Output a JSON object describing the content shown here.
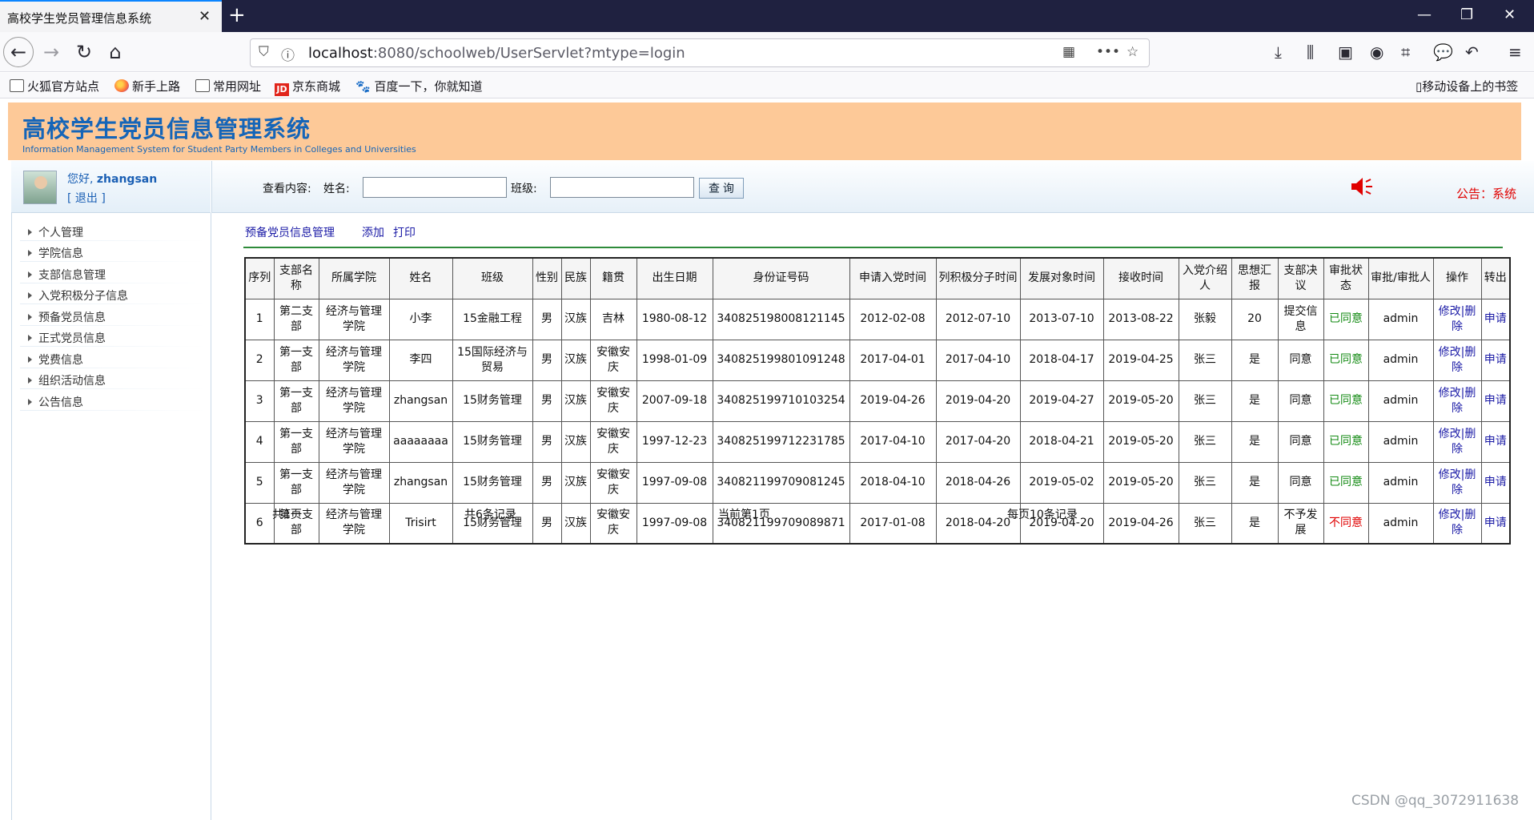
{
  "browser": {
    "tab_title": "高校学生党员管理信息系统",
    "url_host": "localhost",
    "url_rest": ":8080/schoolweb/UserServlet?mtype=login",
    "bookmarks": [
      "火狐官方站点",
      "新手上路",
      "常用网址",
      "京东商城",
      "百度一下，你就知道"
    ],
    "mobile_bookmarks": "移动设备上的书签"
  },
  "header": {
    "title": "高校学生党员信息管理系统",
    "subtitle": "Information Management System for Student Party Members in Colleges and Universities"
  },
  "user": {
    "greeting": "您好,",
    "name": "zhangsan",
    "logout": "[ 退出 ]"
  },
  "search": {
    "prefix": "查看内容:",
    "name_label": "姓名:",
    "name_value": "",
    "class_label": "班级:",
    "class_value": "",
    "button": "查 询",
    "notice": "公告：系统"
  },
  "sidebar": {
    "items": [
      "个人管理",
      "学院信息",
      "支部信息管理",
      "入党积极分子信息",
      "预备党员信息",
      "正式党员信息",
      "党费信息",
      "组织活动信息",
      "公告信息"
    ]
  },
  "content": {
    "section_title": "预备党员信息管理",
    "add": "添加",
    "print": "打印"
  },
  "table": {
    "headers": [
      "序列",
      "支部名称",
      "所属学院",
      "姓名",
      "班级",
      "性别",
      "民族",
      "籍贯",
      "出生日期",
      "身份证号码",
      "申请入党时间",
      "列积极分子时间",
      "发展对象时间",
      "接收时间",
      "入党介绍人",
      "思想汇报",
      "支部决议",
      "审批状态",
      "审批/审批人",
      "操作",
      "转出"
    ],
    "rows": [
      [
        "1",
        "第二支部",
        "经济与管理学院",
        "小李",
        "15金融工程",
        "男",
        "汉族",
        "吉林",
        "1980-08-12",
        "340825198008121145",
        "2012-02-08",
        "2012-07-10",
        "2013-07-10",
        "2013-08-22",
        "张毅",
        "20",
        "提交信息",
        "已同意",
        "admin",
        "修改|删除",
        "申请"
      ],
      [
        "2",
        "第一支部",
        "经济与管理学院",
        "李四",
        "15国际经济与贸易",
        "男",
        "汉族",
        "安徽安庆",
        "1998-01-09",
        "340825199801091248",
        "2017-04-01",
        "2017-04-10",
        "2018-04-17",
        "2019-04-25",
        "张三",
        "是",
        "同意",
        "已同意",
        "admin",
        "修改|删除",
        "申请"
      ],
      [
        "3",
        "第一支部",
        "经济与管理学院",
        "zhangsan",
        "15财务管理",
        "男",
        "汉族",
        "安徽安庆",
        "2007-09-18",
        "340825199710103254",
        "2019-04-26",
        "2019-04-20",
        "2019-04-27",
        "2019-05-20",
        "张三",
        "是",
        "同意",
        "已同意",
        "admin",
        "修改|删除",
        "申请"
      ],
      [
        "4",
        "第一支部",
        "经济与管理学院",
        "aaaaaaaa",
        "15财务管理",
        "男",
        "汉族",
        "安徽安庆",
        "1997-12-23",
        "340825199712231785",
        "2017-04-10",
        "2017-04-20",
        "2018-04-21",
        "2019-05-20",
        "张三",
        "是",
        "同意",
        "已同意",
        "admin",
        "修改|删除",
        "申请"
      ],
      [
        "5",
        "第一支部",
        "经济与管理学院",
        "zhangsan",
        "15财务管理",
        "男",
        "汉族",
        "安徽安庆",
        "1997-09-08",
        "340821199709081245",
        "2018-04-10",
        "2018-04-26",
        "2019-05-02",
        "2019-05-20",
        "张三",
        "是",
        "同意",
        "已同意",
        "admin",
        "修改|删除",
        "申请"
      ],
      [
        "6",
        "第一支部",
        "经济与管理学院",
        "Trisirt",
        "15财务管理",
        "男",
        "汉族",
        "安徽安庆",
        "1997-09-08",
        "340821199709089871",
        "2017-01-08",
        "2018-04-20",
        "2019-04-20",
        "2019-04-26",
        "张三",
        "是",
        "不予发展",
        "不同意",
        "admin",
        "修改|删除",
        "申请"
      ]
    ]
  },
  "pagination": {
    "total_pages": "共1页",
    "total_records": "共6条记录",
    "current_page": "当前第1页",
    "per_page": "每页10条记录"
  },
  "watermark": "CSDN @qq_3072911638",
  "colors": {
    "banner": "#fdc998",
    "title_blue": "#1565b8",
    "approved": "#138a13",
    "rejected": "#e00000",
    "link": "#1a1aa6"
  }
}
